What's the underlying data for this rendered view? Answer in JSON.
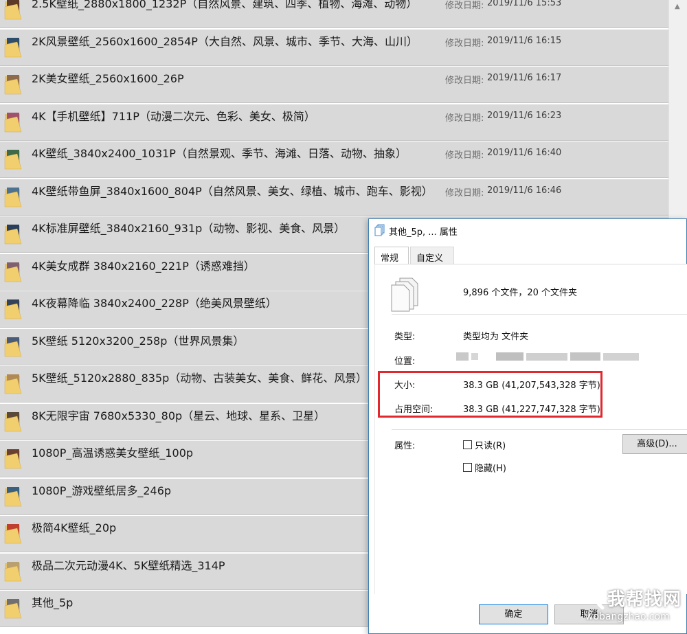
{
  "explorer": {
    "date_label": "修改日期:",
    "rows": [
      {
        "name": "2.5K壁纸_2880x1800_1232P（自然风景、建筑、四季、植物、海滩、动物）",
        "date": "2019/11/6 15:53"
      },
      {
        "name": "2K风景壁纸_2560x1600_2854P（大自然、风景、城市、季节、大海、山川）",
        "date": "2019/11/6 16:15"
      },
      {
        "name": "2K美女壁纸_2560x1600_26P",
        "date": "2019/11/6 16:17"
      },
      {
        "name": "4K【手机壁纸】711P（动漫二次元、色彩、美女、极简）",
        "date": "2019/11/6 16:23"
      },
      {
        "name": "4K壁纸_3840x2400_1031P（自然景观、季节、海滩、日落、动物、抽象）",
        "date": "2019/11/6 16:40"
      },
      {
        "name": "4K壁纸带鱼屏_3840x1600_804P（自然风景、美女、绿植、城市、跑车、影视）",
        "date": "2019/11/6 16:46"
      },
      {
        "name": "4K标准屏壁纸_3840x2160_931p（动物、影视、美食、风景）",
        "date": ""
      },
      {
        "name": "4K美女成群 3840x2160_221P（诱惑难挡）",
        "date": ""
      },
      {
        "name": "4K夜幕降临 3840x2400_228P（绝美风景壁纸）",
        "date": ""
      },
      {
        "name": "5K壁纸 5120x3200_258p（世界风景集）",
        "date": ""
      },
      {
        "name": "5K壁纸_5120x2880_835p（动物、古装美女、美食、鲜花、风景）",
        "date": ""
      },
      {
        "name": "8K无限宇宙 7680x5330_80p（星云、地球、星系、卫星）",
        "date": ""
      },
      {
        "name": "1080P_高温诱惑美女壁纸_100p",
        "date": ""
      },
      {
        "name": "1080P_游戏壁纸居多_246p",
        "date": ""
      },
      {
        "name": "极简4K壁纸_20p",
        "date": ""
      },
      {
        "name": "极品二次元动漫4K、5K壁纸精选_314P",
        "date": ""
      },
      {
        "name": "其他_5p",
        "date": ""
      }
    ]
  },
  "dialog": {
    "title": "其他_5p, ... 属性",
    "tabs": [
      "常规",
      "自定义"
    ],
    "summary": "9,896 个文件，20 个文件夹",
    "type_label": "类型:",
    "type_value": "类型均为 文件夹",
    "location_label": "位置:",
    "size_label": "大小:",
    "size_value": "38.3 GB (41,207,543,328 字节)",
    "disk_label": "占用空间:",
    "disk_value": "38.3 GB (41,227,747,328 字节)",
    "attributes_label": "属性:",
    "readonly_label": "只读(R)",
    "hidden_label": "隐藏(H)",
    "advanced_button": "高级(D)...",
    "ok_button": "确定",
    "cancel_button": "取消"
  },
  "watermark": {
    "text": "我帮找网",
    "url": "wobangzhao.com"
  },
  "colors": {
    "row_bg": "#d9d9d9",
    "highlight": "#e0282e",
    "dialog_border": "#3c7fb1"
  }
}
